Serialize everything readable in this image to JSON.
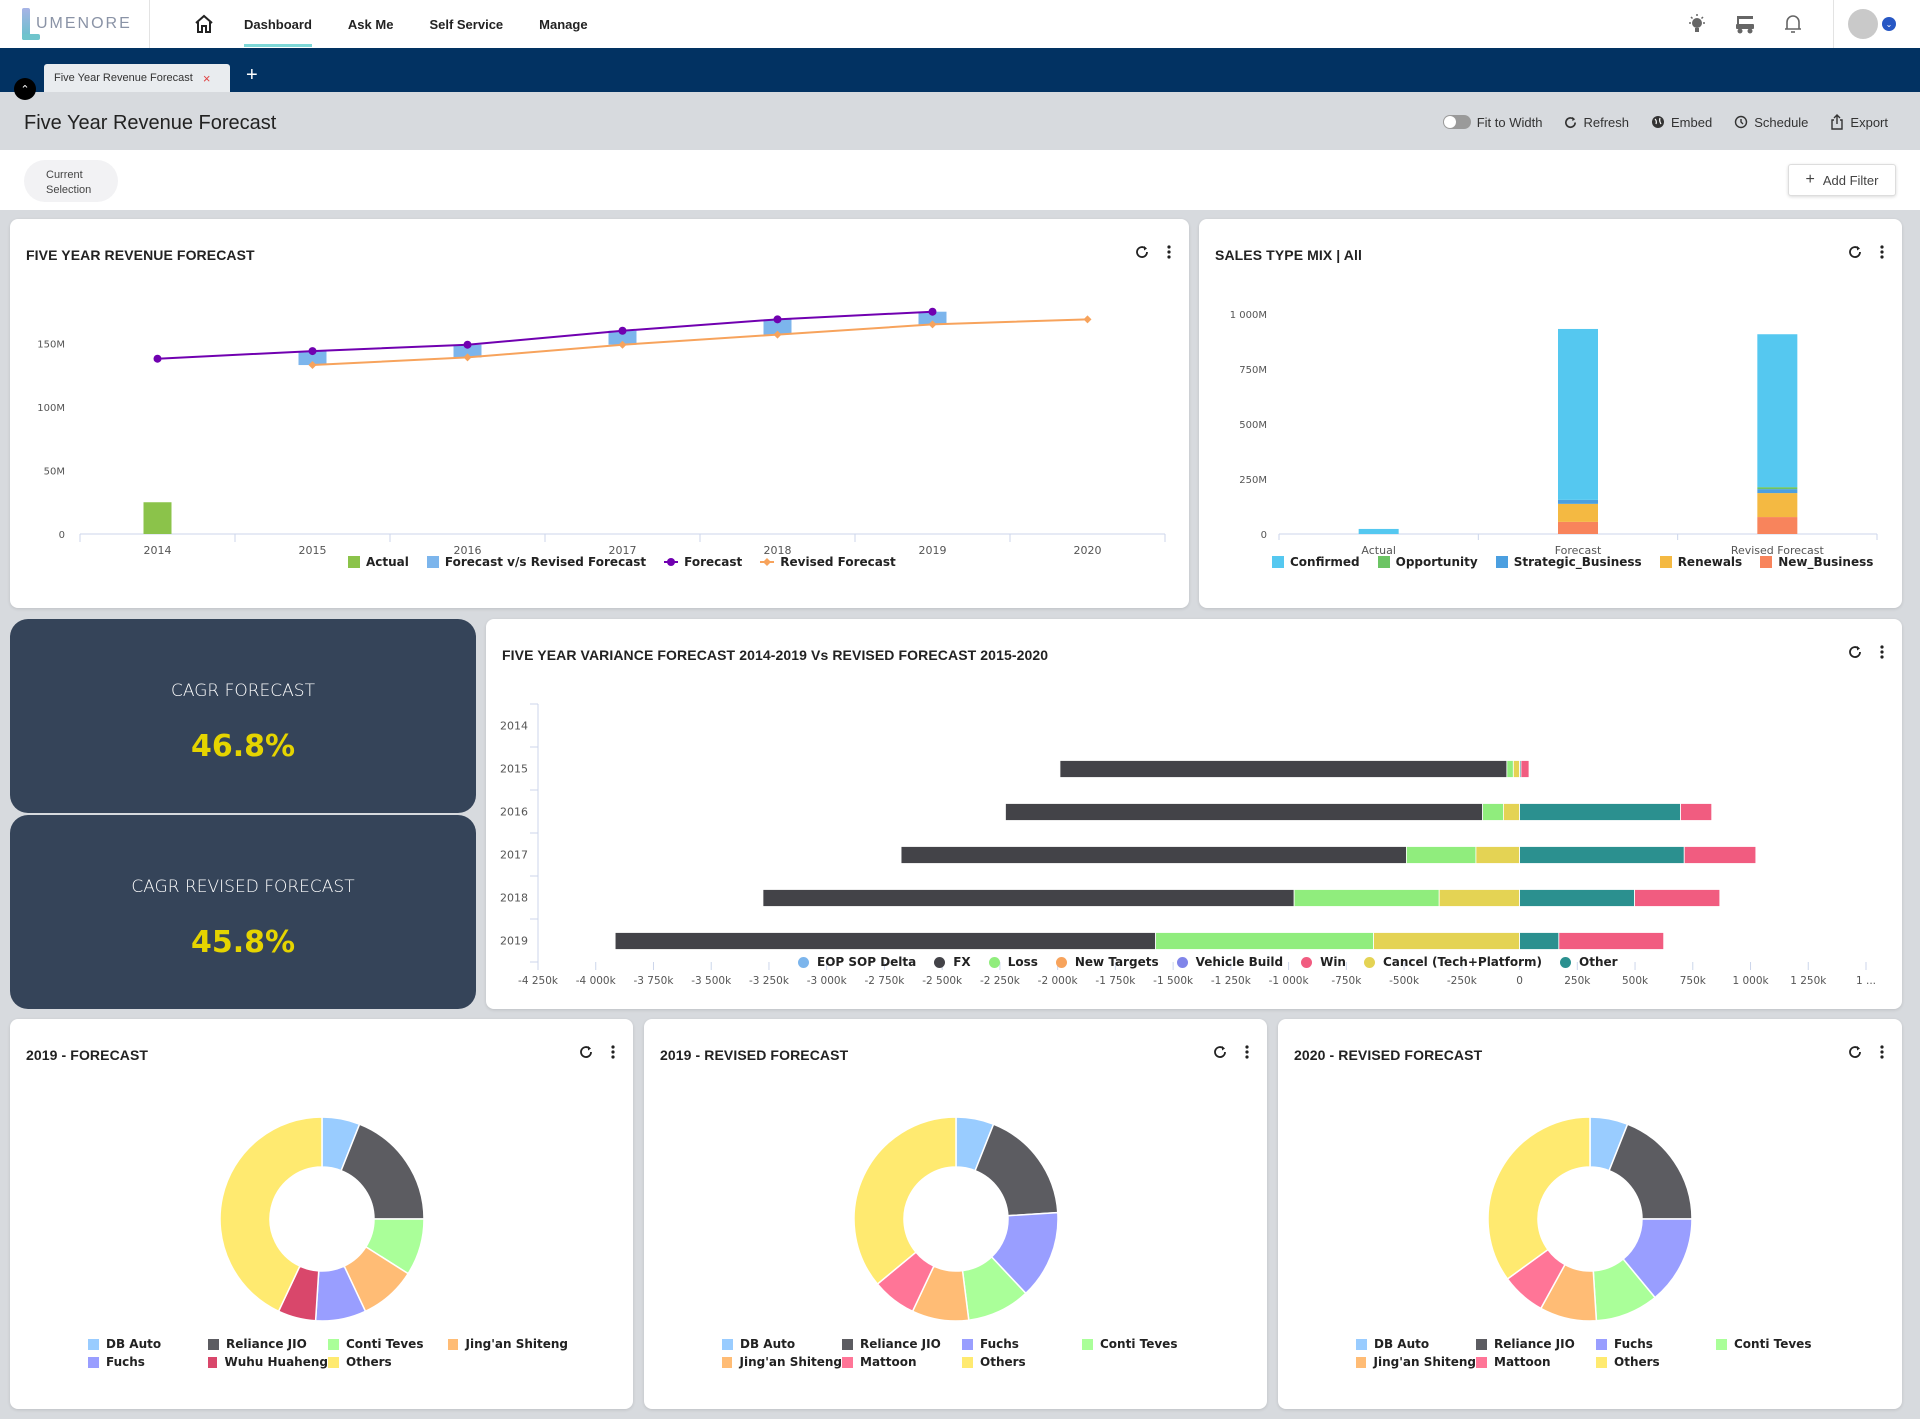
{
  "app": {
    "logo_text": "UMENORE",
    "nav": [
      {
        "label": "Dashboard",
        "active": true
      },
      {
        "label": "Ask Me",
        "active": false
      },
      {
        "label": "Self Service",
        "active": false
      },
      {
        "label": "Manage",
        "active": false
      }
    ],
    "top_icons": [
      "lightbulb-icon",
      "golf-cart-icon",
      "bell-icon"
    ],
    "avatar_dropdown": "chevron-down-icon"
  },
  "tabs": [
    {
      "label": "Five Year Revenue Forecast",
      "close": "×"
    }
  ],
  "tab_add": "+",
  "page": {
    "title": "Five Year Revenue Forecast",
    "actions": {
      "fit_to_width": "Fit to Width",
      "fit_to_width_on": false,
      "refresh": "Refresh",
      "embed": "Embed",
      "schedule": "Schedule",
      "export": "Export"
    }
  },
  "filters": {
    "current_selection_line1": "Current",
    "current_selection_line2": "Selection",
    "add_filter": "Add Filter",
    "add_icon": "+"
  },
  "kpis": [
    {
      "label": "CAGR FORECAST",
      "value": "46.8%"
    },
    {
      "label": "CAGR REVISED FORECAST",
      "value": "45.8%"
    }
  ],
  "chart_data": [
    {
      "id": "revenue",
      "type": "line",
      "title": "FIVE YEAR REVENUE FORECAST",
      "categories": [
        "2014",
        "2015",
        "2016",
        "2017",
        "2018",
        "2019",
        "2020"
      ],
      "yticks": [
        "0",
        "50M",
        "100M",
        "150M"
      ],
      "ylim": [
        0,
        185
      ],
      "unit": "M",
      "series": [
        {
          "name": "Actual",
          "type": "bar",
          "color": "#8bc34a",
          "values": [
            25,
            null,
            null,
            null,
            null,
            null,
            null
          ]
        },
        {
          "name": "Forecast v/s Revised Forecast",
          "type": "range",
          "color": "#7cb5ec",
          "values": [
            null,
            [
              133,
              144
            ],
            [
              139,
              149
            ],
            [
              149,
              160
            ],
            [
              157,
              169
            ],
            [
              165,
              175
            ],
            null
          ]
        },
        {
          "name": "Forecast",
          "type": "line",
          "color": "#7000b0",
          "marker": "circle",
          "values": [
            138,
            144,
            149,
            160,
            169,
            175,
            null
          ]
        },
        {
          "name": "Revised Forecast",
          "type": "line",
          "color": "#f7a35c",
          "marker": "diamond",
          "values": [
            null,
            133,
            139,
            149,
            157,
            165,
            169
          ]
        }
      ]
    },
    {
      "id": "salesmix",
      "type": "bar",
      "stacked": true,
      "title": "SALES TYPE MIX | All",
      "categories": [
        "Actual",
        "Forecast",
        "Revised Forecast"
      ],
      "yticks": [
        "0",
        "250M",
        "500M",
        "750M",
        "1 000M"
      ],
      "ylim": [
        0,
        1000
      ],
      "series": [
        {
          "name": "Confirmed",
          "color": "#55c8f0",
          "values": [
            23,
            777,
            695
          ]
        },
        {
          "name": "Opportunity",
          "color": "#6cc464",
          "values": [
            0,
            0,
            9
          ]
        },
        {
          "name": "Strategic_Business",
          "color": "#4b9fe0",
          "values": [
            0,
            18,
            18
          ]
        },
        {
          "name": "Renewals",
          "color": "#f4b942",
          "values": [
            0,
            82,
            109
          ]
        },
        {
          "name": "New_Business",
          "color": "#f8845c",
          "values": [
            0,
            55,
            77
          ]
        }
      ]
    },
    {
      "id": "variance",
      "type": "bar",
      "orientation": "horizontal",
      "title": "FIVE YEAR VARIANCE FORECAST 2014-2019 Vs REVISED FORECAST 2015-2020",
      "categories": [
        "2014",
        "2015",
        "2016",
        "2017",
        "2018",
        "2019"
      ],
      "xlim": [
        -4250,
        1500
      ],
      "xticks": [
        "-4 250k",
        "-4 000k",
        "-3 750k",
        "-3 500k",
        "-3 250k",
        "-3 000k",
        "-2 750k",
        "-2 500k",
        "-2 250k",
        "-2 000k",
        "-1 750k",
        "-1 500k",
        "-1 250k",
        "-1 000k",
        "-750k",
        "-500k",
        "-250k",
        "0",
        "250k",
        "500k",
        "750k",
        "1 000k",
        "1 250k",
        "1 ..."
      ],
      "legend": [
        {
          "name": "EOP SOP Delta",
          "color": "#7cb5ec"
        },
        {
          "name": "FX",
          "color": "#434348"
        },
        {
          "name": "Loss",
          "color": "#90ed7d"
        },
        {
          "name": "New Targets",
          "color": "#f7a35c"
        },
        {
          "name": "Vehicle Build",
          "color": "#8085e9"
        },
        {
          "name": "Win",
          "color": "#f15c80"
        },
        {
          "name": "Cancel (Tech+Platform)",
          "color": "#e4d354"
        },
        {
          "name": "Other",
          "color": "#2b908f"
        }
      ],
      "segments": [
        [],
        [
          {
            "s": "FX",
            "from": -1990,
            "to": -55
          },
          {
            "s": "Loss",
            "from": -55,
            "to": -27
          },
          {
            "s": "Cancel (Tech+Platform)",
            "from": -27,
            "to": 0
          },
          {
            "s": "Other",
            "from": 0,
            "to": 6
          },
          {
            "s": "Win",
            "from": 6,
            "to": 41
          }
        ],
        [
          {
            "s": "FX",
            "from": -2226,
            "to": -160
          },
          {
            "s": "Loss",
            "from": -160,
            "to": -70
          },
          {
            "s": "Cancel (Tech+Platform)",
            "from": -70,
            "to": 0
          },
          {
            "s": "Other",
            "from": 0,
            "to": 697
          },
          {
            "s": "Win",
            "from": 697,
            "to": 832
          }
        ],
        [
          {
            "s": "FX",
            "from": -2678,
            "to": -490
          },
          {
            "s": "Loss",
            "from": -490,
            "to": -189
          },
          {
            "s": "Cancel (Tech+Platform)",
            "from": -189,
            "to": 0
          },
          {
            "s": "Other",
            "from": 0,
            "to": 713
          },
          {
            "s": "Win",
            "from": 713,
            "to": 1023
          }
        ],
        [
          {
            "s": "FX",
            "from": -3276,
            "to": -976
          },
          {
            "s": "Loss",
            "from": -976,
            "to": -348
          },
          {
            "s": "Cancel (Tech+Platform)",
            "from": -348,
            "to": 0
          },
          {
            "s": "Other",
            "from": 0,
            "to": 498
          },
          {
            "s": "Win",
            "from": 498,
            "to": 867
          }
        ],
        [
          {
            "s": "FX",
            "from": -3916,
            "to": -1576
          },
          {
            "s": "Loss",
            "from": -1576,
            "to": -632
          },
          {
            "s": "Cancel (Tech+Platform)",
            "from": -632,
            "to": 0
          },
          {
            "s": "Other",
            "from": 0,
            "to": 170
          },
          {
            "s": "Win",
            "from": 170,
            "to": 624
          }
        ]
      ]
    },
    {
      "id": "pie2019f",
      "type": "pie",
      "donut": true,
      "title": "2019 - FORECAST",
      "slices": [
        {
          "name": "DB Auto",
          "color": "#99ccff",
          "value": 6
        },
        {
          "name": "Reliance JIO",
          "color": "#5c5c61",
          "value": 19
        },
        {
          "name": "Conti Teves",
          "color": "#aaff99",
          "value": 9
        },
        {
          "name": "Jing'an Shiteng",
          "color": "#ffbc75",
          "value": 9
        },
        {
          "name": "Fuchs",
          "color": "#999eff",
          "value": 8
        },
        {
          "name": "Wuhu Huaheng",
          "color": "#d9476b",
          "value": 6
        },
        {
          "name": "Others",
          "color": "#ffea70",
          "value": 43
        }
      ],
      "legend_order": [
        "DB Auto",
        "Reliance JIO",
        "Conti Teves",
        "Jing'an Shiteng",
        "Fuchs",
        "Wuhu Huaheng",
        "Others"
      ]
    },
    {
      "id": "pie2019r",
      "type": "pie",
      "donut": true,
      "title": "2019 - REVISED FORECAST",
      "slices": [
        {
          "name": "DB Auto",
          "color": "#99ccff",
          "value": 6
        },
        {
          "name": "Reliance JIO",
          "color": "#5c5c61",
          "value": 18
        },
        {
          "name": "Fuchs",
          "color": "#999eff",
          "value": 14
        },
        {
          "name": "Conti Teves",
          "color": "#aaff99",
          "value": 10
        },
        {
          "name": "Jing'an Shiteng",
          "color": "#ffbc75",
          "value": 9
        },
        {
          "name": "Mattoon",
          "color": "#ff7597",
          "value": 7
        },
        {
          "name": "Others",
          "color": "#ffea70",
          "value": 36
        }
      ],
      "legend_order": [
        "DB Auto",
        "Reliance JIO",
        "Fuchs",
        "Conti Teves",
        "Jing'an Shiteng",
        "Mattoon",
        "Others"
      ]
    },
    {
      "id": "pie2020r",
      "type": "pie",
      "donut": true,
      "title": "2020 - REVISED FORECAST",
      "slices": [
        {
          "name": "DB Auto",
          "color": "#99ccff",
          "value": 6
        },
        {
          "name": "Reliance JIO",
          "color": "#5c5c61",
          "value": 19
        },
        {
          "name": "Fuchs",
          "color": "#999eff",
          "value": 14
        },
        {
          "name": "Conti Teves",
          "color": "#aaff99",
          "value": 10
        },
        {
          "name": "Jing'an Shiteng",
          "color": "#ffbc75",
          "value": 9
        },
        {
          "name": "Mattoon",
          "color": "#ff7597",
          "value": 7
        },
        {
          "name": "Others",
          "color": "#ffea70",
          "value": 35
        }
      ],
      "legend_order": [
        "DB Auto",
        "Reliance JIO",
        "Fuchs",
        "Conti Teves",
        "Jing'an Shiteng",
        "Mattoon",
        "Others"
      ]
    }
  ]
}
